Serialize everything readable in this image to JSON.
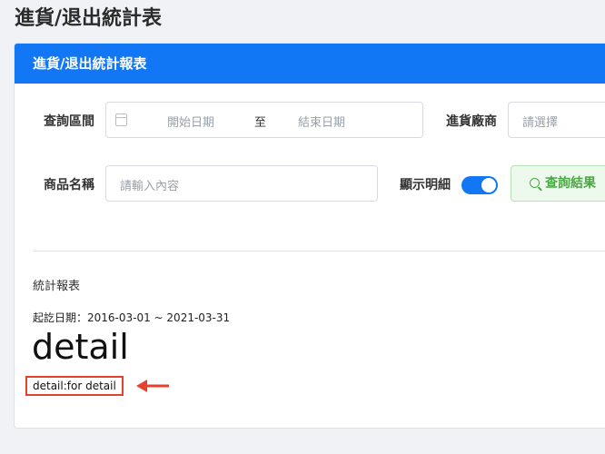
{
  "page": {
    "title": "進貨/退出統計表"
  },
  "card": {
    "header": "進貨/退出統計報表"
  },
  "form": {
    "query_range_label": "查詢區間",
    "start_date_placeholder": "開始日期",
    "date_separator": "至",
    "end_date_placeholder": "結束日期",
    "vendor_label": "進貨廠商",
    "vendor_placeholder": "請選擇",
    "product_label": "商品名稱",
    "product_placeholder": "請輸入內容",
    "show_detail_label": "顯示明細",
    "show_detail_on": true,
    "query_button": "查詢結果"
  },
  "report": {
    "section_title": "統計報表",
    "date_range": "起訖日期：2016-03-01 ~ 2021-03-31",
    "detail_heading": "detail",
    "detail_note": "detail:for detail"
  },
  "colors": {
    "primary": "#1177f4",
    "success": "#4aa844",
    "annotation": "#e8402e"
  }
}
